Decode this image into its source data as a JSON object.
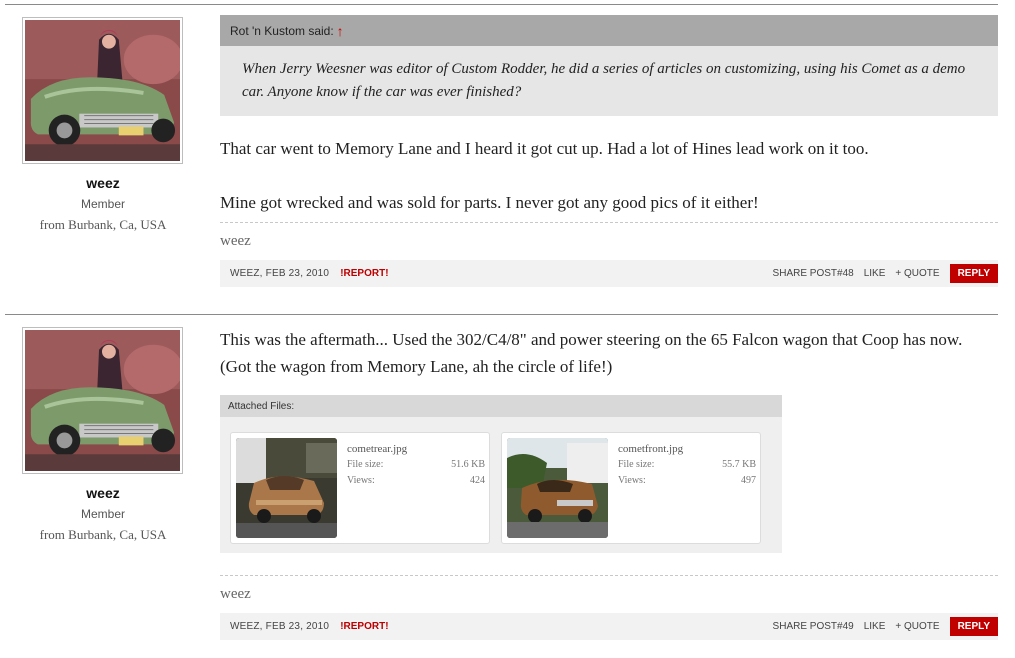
{
  "post48": {
    "user": {
      "name": "weez",
      "title": "Member",
      "location": "from Burbank, Ca, USA"
    },
    "quote": {
      "author": "Rot 'n Kustom said:",
      "arrow": "↑",
      "text": "When Jerry Weesner was editor of Custom Rodder, he did a series of articles on customizing, using his Comet as a demo car. Anyone know if the car was ever finished?"
    },
    "message_lines": [
      "That car went to Memory Lane and I heard it got cut up. Had a lot of Hines lead work on it too.",
      "Mine got wrecked and was sold for parts. I never got any good pics of it either!"
    ],
    "signature": "weez",
    "footer": {
      "author_date": "weez, Feb 23, 2010",
      "report": "!Report!",
      "share": "Share Post#48",
      "like": "Like",
      "quote": "+ Quote",
      "reply": "Reply"
    }
  },
  "post49": {
    "user": {
      "name": "weez",
      "title": "Member",
      "location": "from Burbank, Ca, USA"
    },
    "message_lines": [
      "This was the aftermath... Used the 302/C4/8\" and power steering on the 65 Falcon wagon that Coop has now.",
      "(Got the wagon from Memory Lane, ah the circle of life!)"
    ],
    "attachments": {
      "heading": "Attached Files:",
      "files": [
        {
          "name": "cometrear.jpg",
          "size_label": "File size:",
          "size": "51.6 KB",
          "views_label": "Views:",
          "views": "424"
        },
        {
          "name": "cometfront.jpg",
          "size_label": "File size:",
          "size": "55.7 KB",
          "views_label": "Views:",
          "views": "497"
        }
      ]
    },
    "signature": "weez",
    "footer": {
      "author_date": "weez, Feb 23, 2010",
      "report": "!Report!",
      "share": "Share Post#49",
      "like": "Like",
      "quote": "+ Quote",
      "reply": "Reply"
    }
  },
  "colors": {
    "reply_bg": "#c00000",
    "report": "#bb0000",
    "quote_head": "#a8a8a8",
    "quote_body": "#e6e6e6"
  }
}
